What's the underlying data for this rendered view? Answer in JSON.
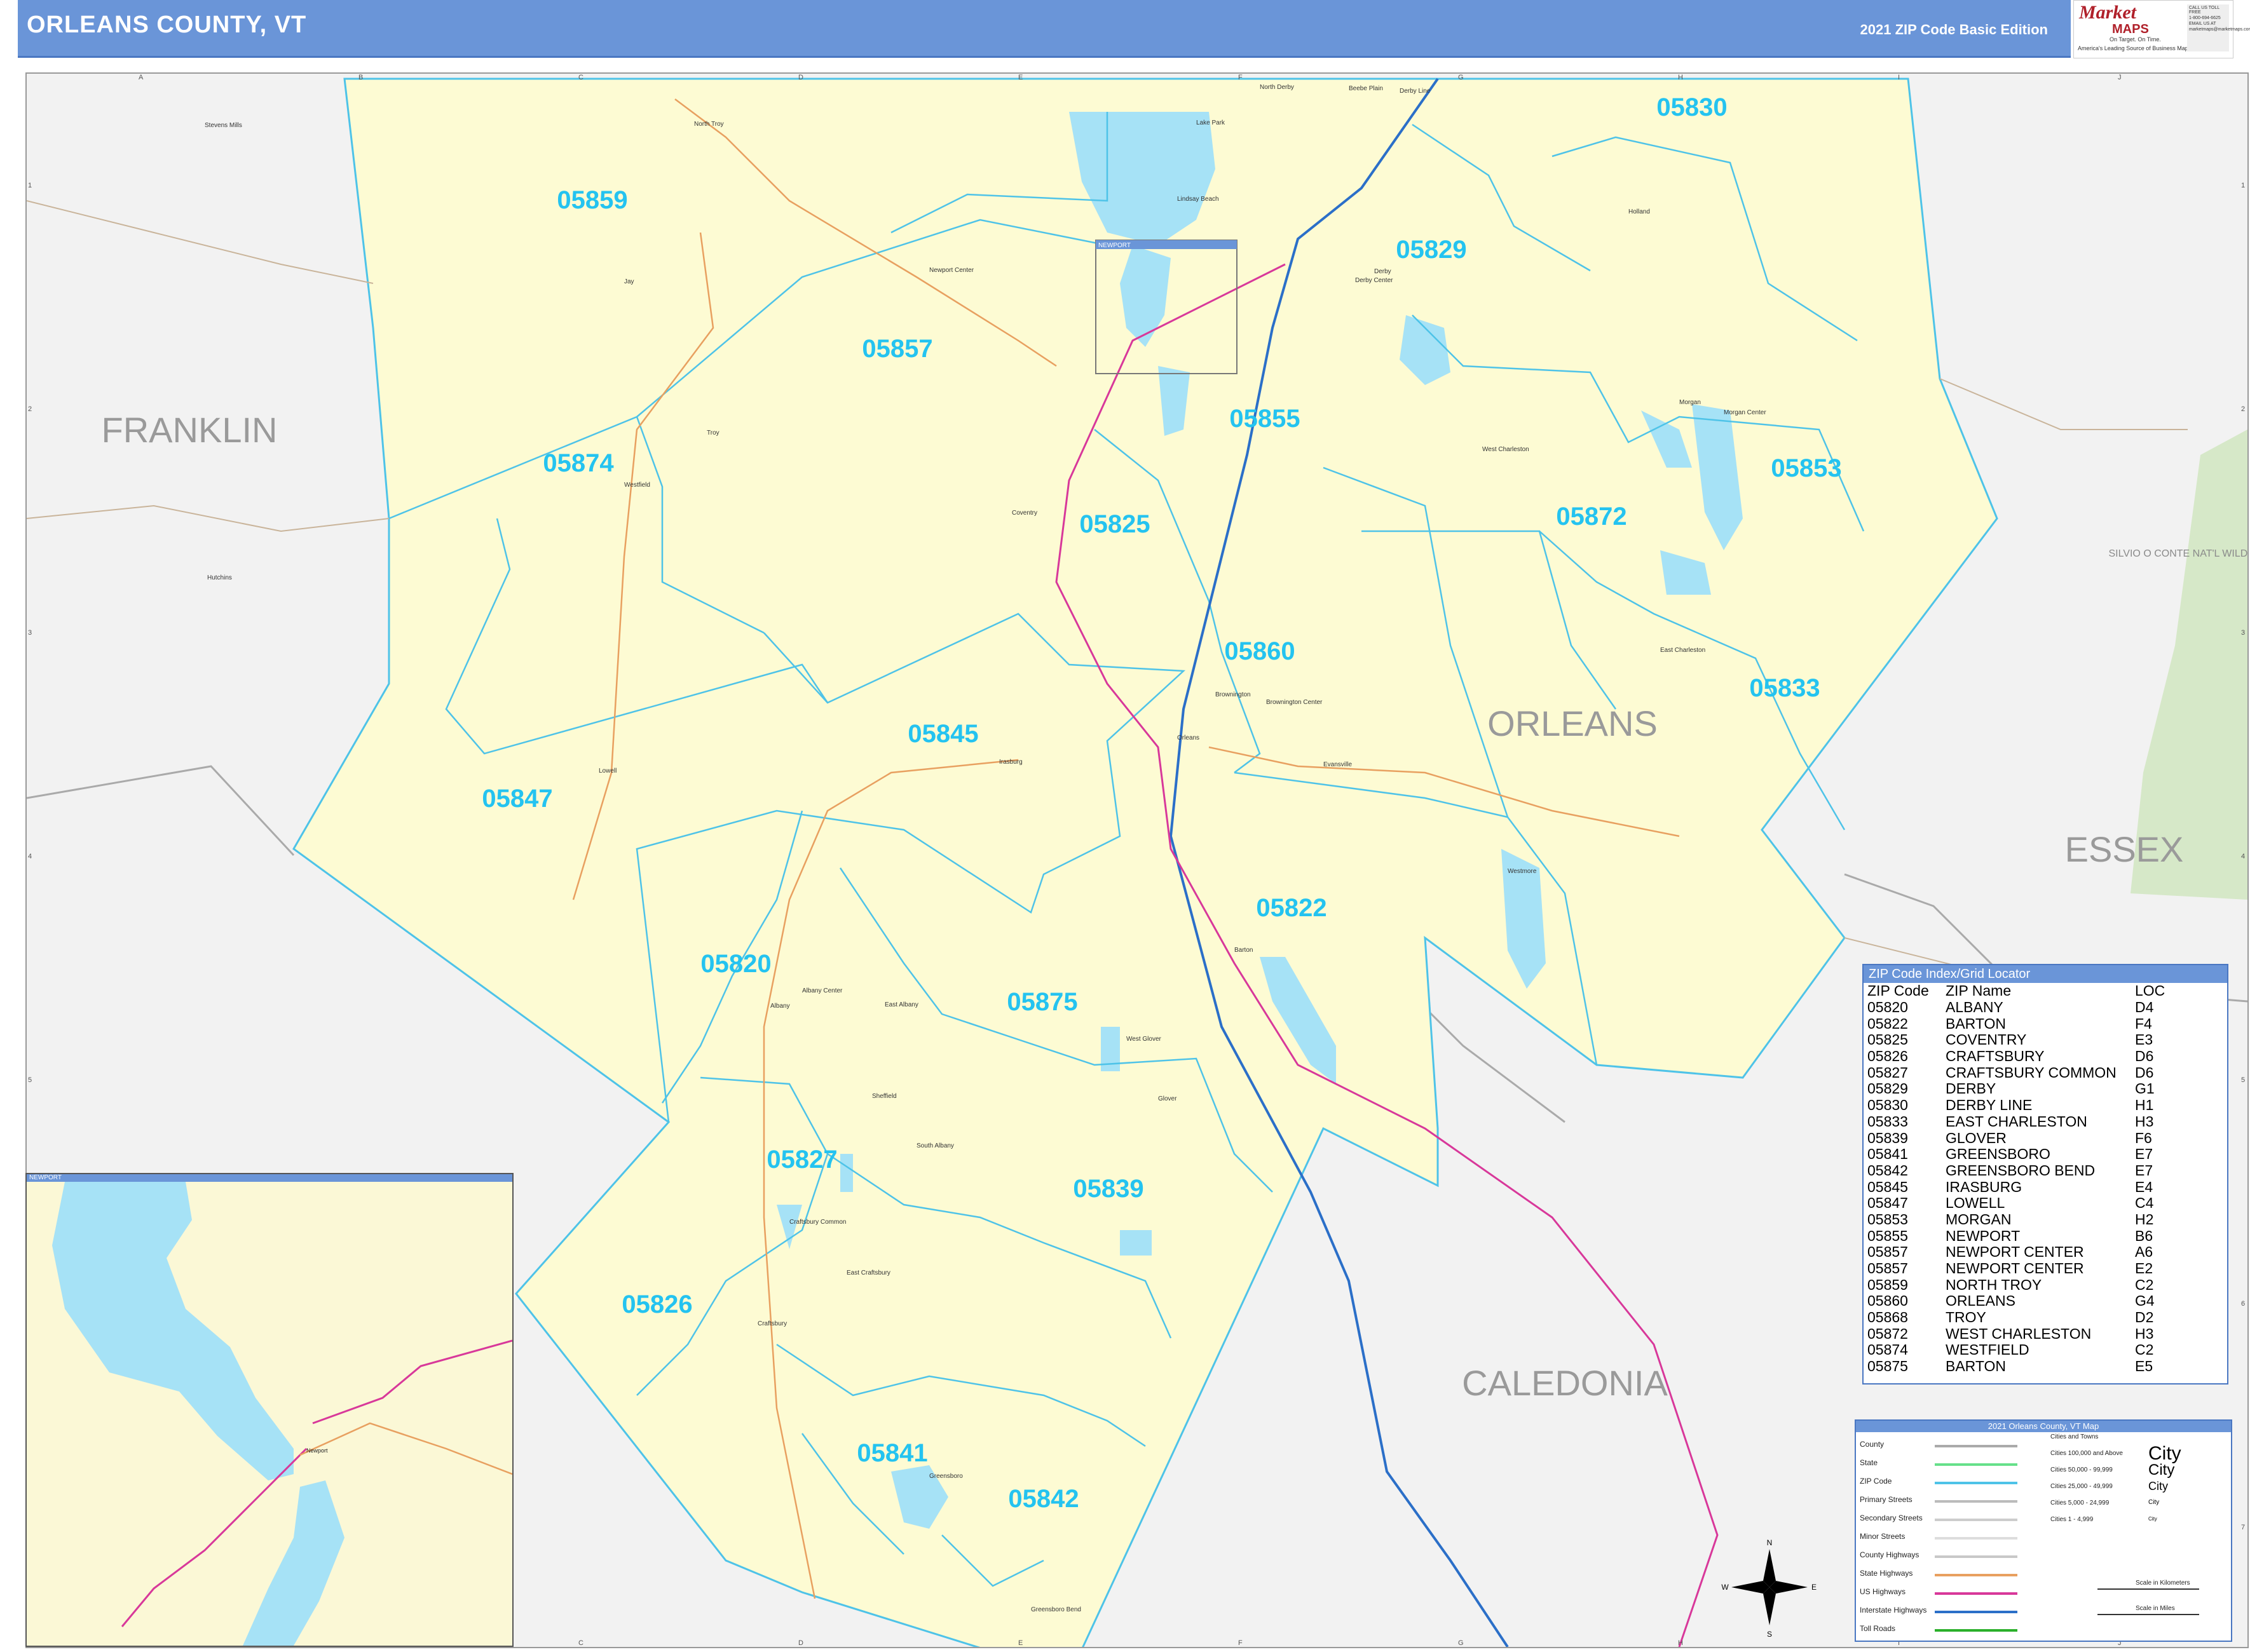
{
  "header": {
    "title": "ORLEANS COUNTY, VT",
    "edition": "2021 ZIP Code Basic Edition"
  },
  "logo": {
    "name": "Market",
    "maps": "MAPS",
    "tagline": "On Target. On Time.",
    "tagline2": "America's Leading Source of Business Maps",
    "contact_line1": "CALL US TOLL FREE",
    "contact_line2": "1-800-694-6625",
    "contact_line3": "EMAIL US AT",
    "contact_line4": "marketmaps@marketmaps.com"
  },
  "grid": {
    "columns": [
      "A",
      "B",
      "C",
      "D",
      "E",
      "F",
      "G",
      "H",
      "I",
      "J"
    ],
    "rows": [
      "1",
      "2",
      "3",
      "4",
      "5",
      "6",
      "7"
    ]
  },
  "counties": {
    "franklin": "FRANKLIN",
    "orleans": "ORLEANS",
    "essex": "ESSEX",
    "caledonia": "CALEDONIA",
    "refuge": "SILVIO O CONTE NAT'L WILDLIFE REF"
  },
  "zip_labels": [
    {
      "zip": "05830"
    },
    {
      "zip": "05859"
    },
    {
      "zip": "05829"
    },
    {
      "zip": "05857"
    },
    {
      "zip": "05874"
    },
    {
      "zip": "05855"
    },
    {
      "zip": "05853"
    },
    {
      "zip": "05872"
    },
    {
      "zip": "05825"
    },
    {
      "zip": "05860"
    },
    {
      "zip": "05833"
    },
    {
      "zip": "05845"
    },
    {
      "zip": "05847"
    },
    {
      "zip": "05822"
    },
    {
      "zip": "05820"
    },
    {
      "zip": "05875"
    },
    {
      "zip": "05827"
    },
    {
      "zip": "05839"
    },
    {
      "zip": "05826"
    },
    {
      "zip": "05841"
    },
    {
      "zip": "05842"
    }
  ],
  "towns": [
    "Stevens Mills",
    "North Troy",
    "North Derby",
    "Beebe Plain",
    "Derby Line",
    "Lake Park",
    "Lindsay Beach",
    "Newport Center",
    "Jay",
    "Holland",
    "Derby",
    "Derby Center",
    "Troy",
    "Westfield",
    "Morgan",
    "Morgan Center",
    "West Charleston",
    "Coventry",
    "Hutchins",
    "East Charleston",
    "Brownington",
    "Brownington Center",
    "Orleans",
    "Irasburg",
    "Evansville",
    "Lowell",
    "Westmore",
    "Barton",
    "Albany Center",
    "Albany",
    "East Albany",
    "West Glover",
    "Glover",
    "Sheffield",
    "South Albany",
    "Craftsbury Common",
    "East Craftsbury",
    "Craftsbury",
    "Greensboro",
    "Greensboro Bend"
  ],
  "inset": {
    "title": "NEWPORT",
    "town": "Newport"
  },
  "zip_index": {
    "title": "ZIP Code Index/Grid Locator",
    "headers": [
      "ZIP Code",
      "ZIP Name",
      "LOC"
    ],
    "rows": [
      [
        "05820",
        "ALBANY",
        "D4"
      ],
      [
        "05822",
        "BARTON",
        "F4"
      ],
      [
        "05825",
        "COVENTRY",
        "E3"
      ],
      [
        "05826",
        "CRAFTSBURY",
        "D6"
      ],
      [
        "05827",
        "CRAFTSBURY COMMON",
        "D6"
      ],
      [
        "05829",
        "DERBY",
        "G1"
      ],
      [
        "05830",
        "DERBY LINE",
        "H1"
      ],
      [
        "05833",
        "EAST CHARLESTON",
        "H3"
      ],
      [
        "05839",
        "GLOVER",
        "F6"
      ],
      [
        "05841",
        "GREENSBORO",
        "E7"
      ],
      [
        "05842",
        "GREENSBORO BEND",
        "E7"
      ],
      [
        "05845",
        "IRASBURG",
        "E4"
      ],
      [
        "05847",
        "LOWELL",
        "C4"
      ],
      [
        "05853",
        "MORGAN",
        "H2"
      ],
      [
        "05855",
        "NEWPORT",
        "B6"
      ],
      [
        "05857",
        "NEWPORT CENTER",
        "A6"
      ],
      [
        "05857",
        "NEWPORT CENTER",
        "E2"
      ],
      [
        "05859",
        "NORTH TROY",
        "C2"
      ],
      [
        "05860",
        "ORLEANS",
        "G4"
      ],
      [
        "05868",
        "TROY",
        "D2"
      ],
      [
        "05872",
        "WEST CHARLESTON",
        "H3"
      ],
      [
        "05874",
        "WESTFIELD",
        "C2"
      ],
      [
        "05875",
        "BARTON",
        "E5"
      ]
    ]
  },
  "legend": {
    "title": "2021 Orleans County, VT Map",
    "cities_header": "Cities and Towns",
    "items": [
      {
        "label": "County",
        "color": "#aaaaaa"
      },
      {
        "label": "State",
        "color": "#66e08a"
      },
      {
        "label": "ZIP Code",
        "color": "#4ec3e8"
      },
      {
        "label": "Primary Streets",
        "color": "#bbbbbb"
      },
      {
        "label": "Secondary Streets",
        "color": "#cccccc"
      },
      {
        "label": "Minor Streets",
        "color": "#dddddd"
      },
      {
        "label": "County Highways",
        "color": "#c8c8c8"
      },
      {
        "label": "State Highways",
        "color": "#e8a060"
      },
      {
        "label": "US Highways",
        "color": "#d8389a"
      },
      {
        "label": "Interstate Highways",
        "color": "#2b6fc8"
      },
      {
        "label": "Toll Roads",
        "color": "#2bb02b"
      }
    ],
    "cities": [
      {
        "label": "Cities 100,000 and Above",
        "sample": "City"
      },
      {
        "label": "Cities 50,000 - 99,999",
        "sample": "City"
      },
      {
        "label": "Cities 25,000 - 49,999",
        "sample": "City"
      },
      {
        "label": "Cities 5,000 - 24,999",
        "sample": "City"
      },
      {
        "label": "Cities 1 - 4,999",
        "sample": "City"
      }
    ],
    "scale_km": "Scale in Kilometers",
    "scale_mi": "Scale in Miles"
  },
  "compass": {
    "n": "N",
    "s": "S",
    "e": "E",
    "w": "W"
  },
  "colors": {
    "header": "#6a95d8",
    "county_fill": "#fdfbd3",
    "zip_line": "#4ec3e8",
    "zip_label": "#24c3f0",
    "water": "#a6e2f6",
    "interstate": "#2b6fc8",
    "us_highway": "#d8389a",
    "state_highway": "#e8a060",
    "refuge": "#d6e8c8"
  }
}
